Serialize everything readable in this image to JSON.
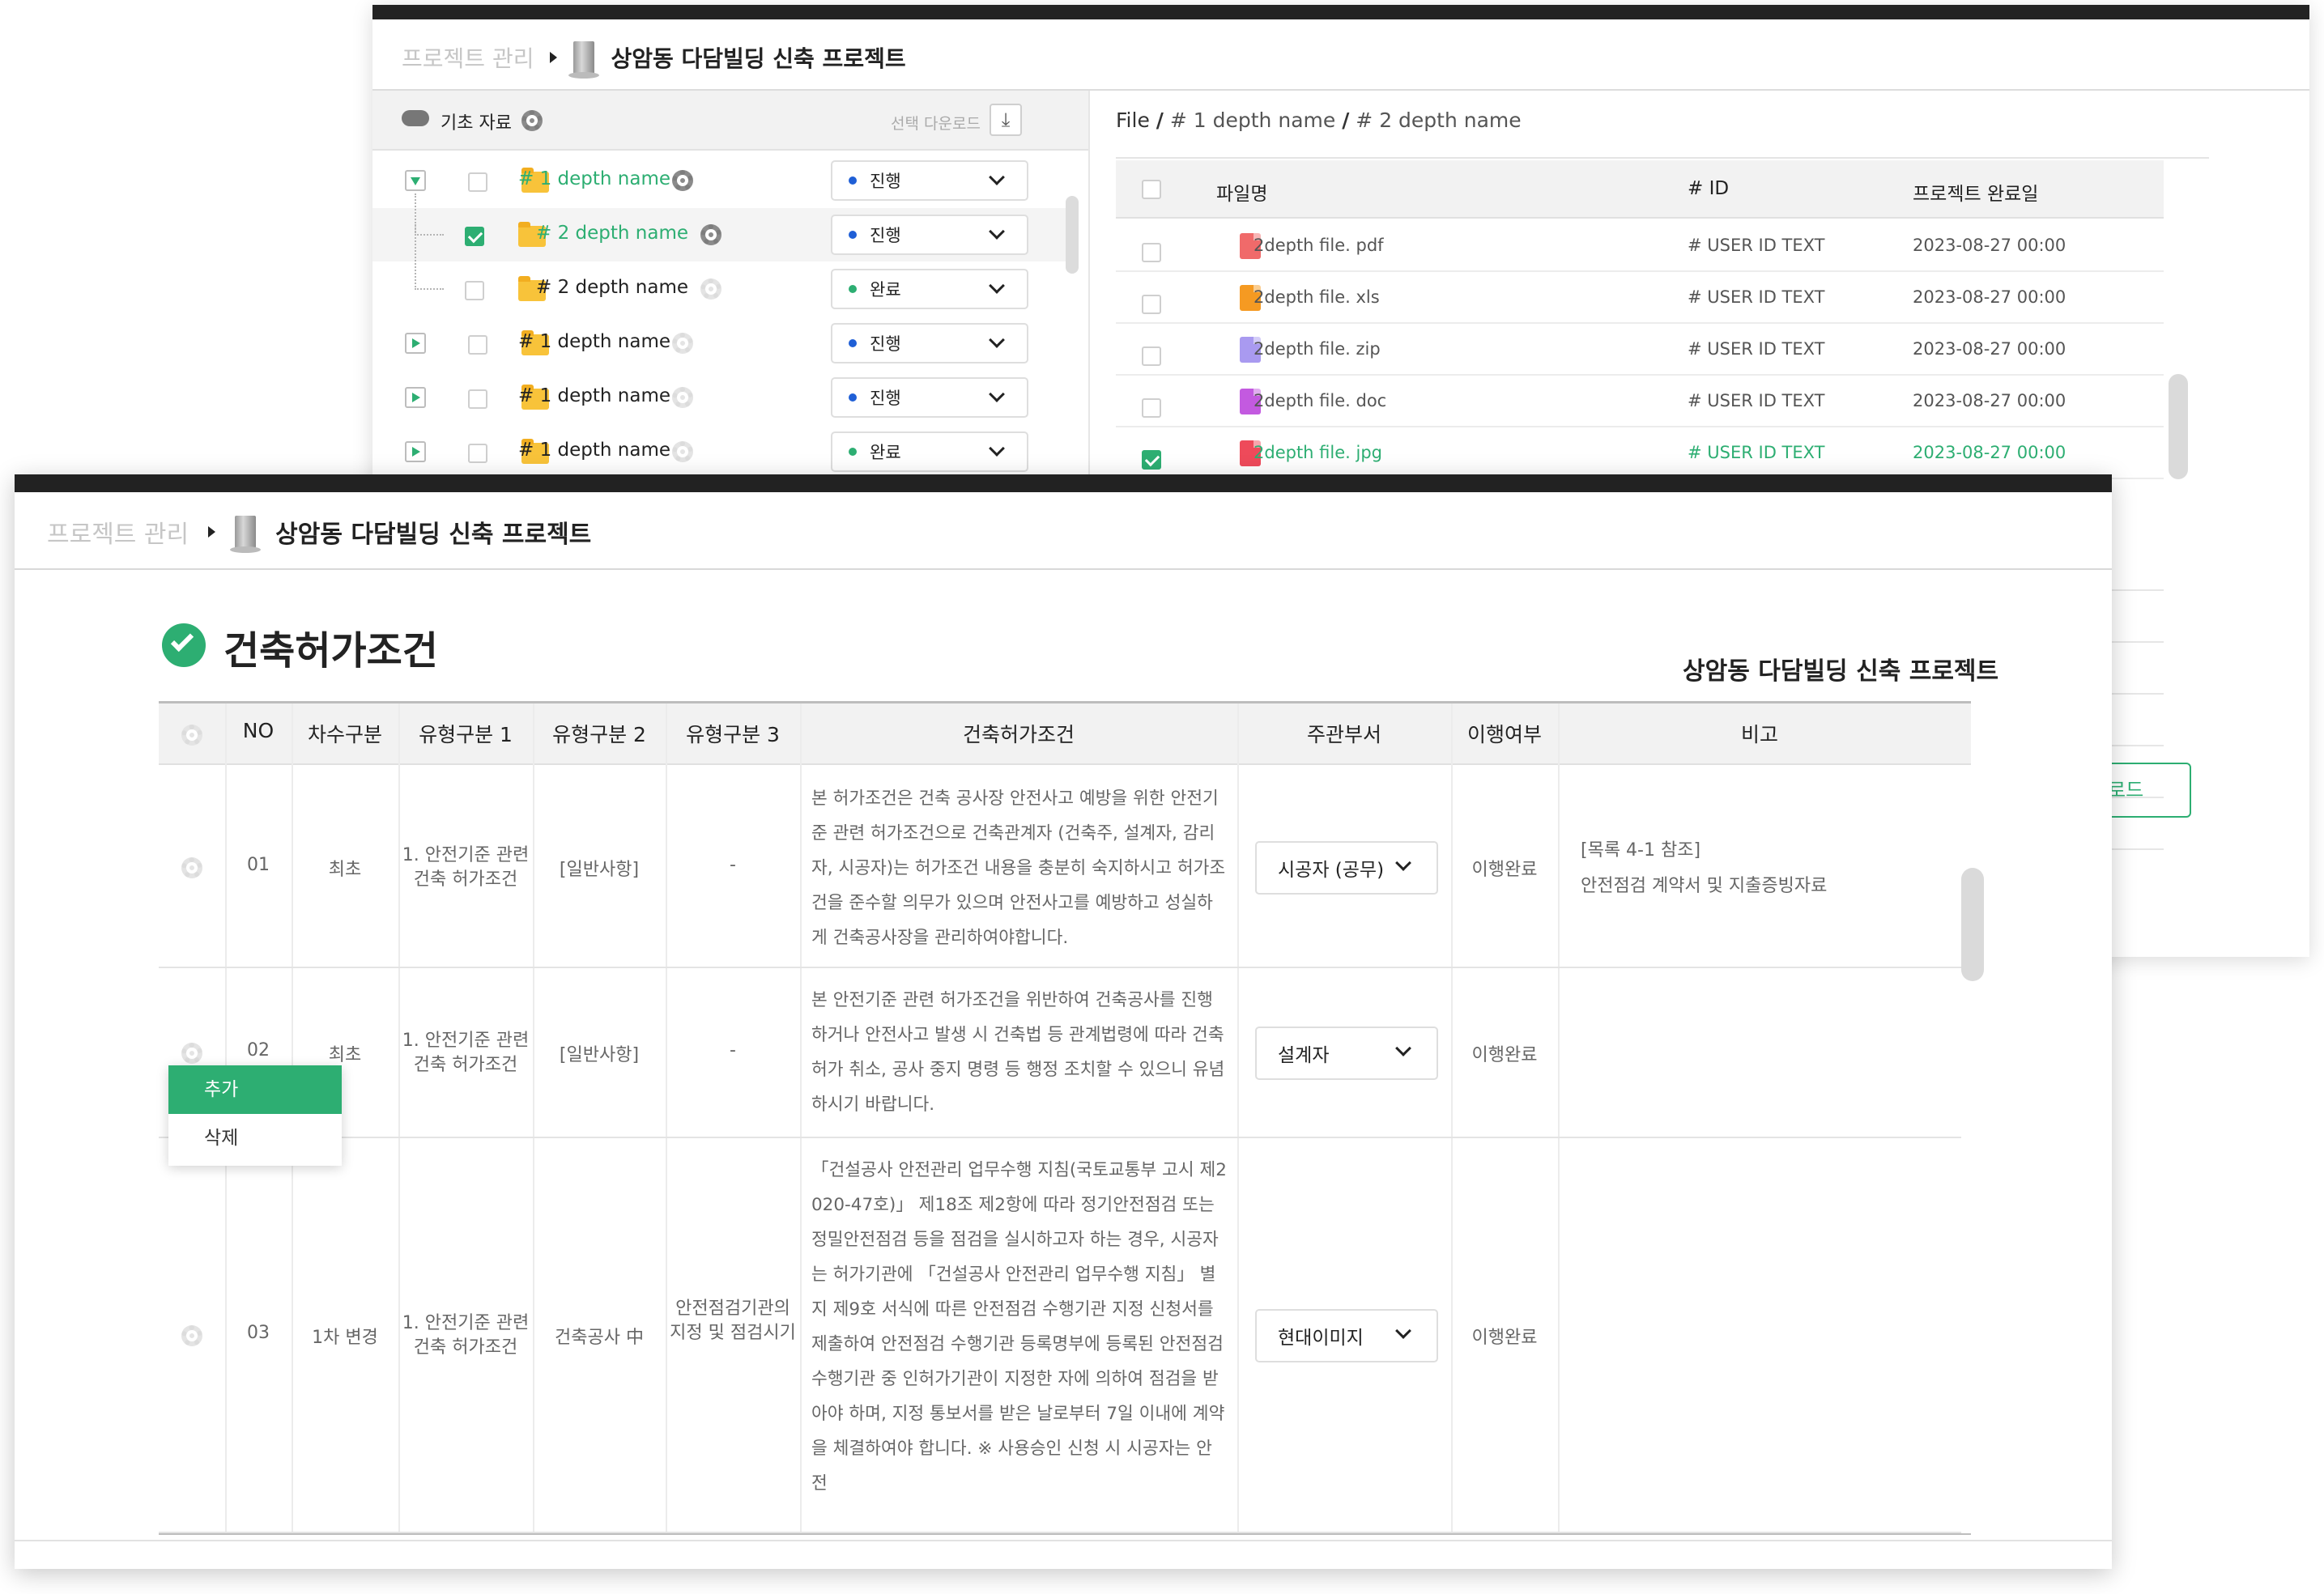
{
  "back_window": {
    "breadcrumb_root": "프로젝트 관리",
    "project_title": "상암동 다담빌딩 신축 프로젝트",
    "tree_header": {
      "label": "기초 자료",
      "download": "선택 다운로드"
    },
    "tree_items": [
      {
        "toggle": "open",
        "checked": false,
        "name": "# 1 depth name",
        "active": true,
        "status": "진행",
        "status_color": "#1f5fd6"
      },
      {
        "toggle": "none",
        "checked": true,
        "name": "# 2 depth name",
        "active": true,
        "status": "진행",
        "status_color": "#1f5fd6"
      },
      {
        "toggle": "none",
        "checked": false,
        "name": "# 2 depth name",
        "active": false,
        "status": "완료",
        "status_color": "#2dae72"
      },
      {
        "toggle": "closed",
        "checked": false,
        "name": "# 1 depth name",
        "active": false,
        "status": "진행",
        "status_color": "#1f5fd6"
      },
      {
        "toggle": "closed",
        "checked": false,
        "name": "# 1 depth name",
        "active": false,
        "status": "진행",
        "status_color": "#1f5fd6"
      },
      {
        "toggle": "closed",
        "checked": false,
        "name": "# 1 depth name",
        "active": false,
        "status": "완료",
        "status_color": "#2dae72"
      }
    ],
    "file_path": {
      "root": "File",
      "sep": "/",
      "d1": "# 1 depth name",
      "d2": "# 2 depth name"
    },
    "file_table": {
      "headers": [
        "파일명",
        "# ID",
        "프로젝트 완료일"
      ],
      "rows": [
        {
          "name": "2depth file. pdf",
          "type": "PDF",
          "color": "#f06a6a",
          "id": "# USER ID TEXT",
          "date": "2023-08-27 00:00",
          "checked": false
        },
        {
          "name": "2depth file. xls",
          "type": "XLS",
          "color": "#f59a22",
          "id": "# USER ID TEXT",
          "date": "2023-08-27 00:00",
          "checked": false
        },
        {
          "name": "2depth file. zip",
          "type": "ZIP",
          "color": "#a99af0",
          "id": "# USER ID TEXT",
          "date": "2023-08-27 00:00",
          "checked": false
        },
        {
          "name": "2depth file. doc",
          "type": "DOC",
          "color": "#c35ae0",
          "id": "# USER ID TEXT",
          "date": "2023-08-27 00:00",
          "checked": false
        },
        {
          "name": "2depth file. jpg",
          "type": "JPG",
          "color": "#ee4a5a",
          "id": "# USER ID TEXT",
          "date": "2023-08-27 00:00",
          "checked": true
        }
      ]
    },
    "download_button": "다운로드"
  },
  "front_window": {
    "breadcrumb_root": "프로젝트 관리",
    "project_title": "상암동 다담빌딩 신축 프로젝트",
    "page_title": "건축허가조건",
    "project_label": "상암동 다담빌딩 신축 프로젝트",
    "table": {
      "headers": [
        "NO",
        "차수구분",
        "유형구분 1",
        "유형구분 2",
        "유형구분 3",
        "건축허가조건",
        "주관부서",
        "이행여부",
        "비고"
      ],
      "rows": [
        {
          "no": "01",
          "degree": "최초",
          "type1": "1. 안전기준 관련 건축 허가조건",
          "type2": "[일반사항]",
          "type3": "-",
          "condition": "본 허가조건은 건축 공사장 안전사고 예방을 위한 안전기준 관련 허가조건으로 건축관계자 (건축주, 설계자, 감리자, 시공자)는 허가조건 내용을 충분히 숙지하시고 허가조건을 준수할 의무가 있으며 안전사고를 예방하고 성실하게 건축공사장을 관리하여야합니다.",
          "dept": "시공자 (공무)",
          "done": "이행완료",
          "note1": "[목록 4-1 참조]",
          "note2": "안전점검 계약서 및 지출증빙자료"
        },
        {
          "no": "02",
          "degree": "최초",
          "type1": "1. 안전기준 관련 건축 허가조건",
          "type2": "[일반사항]",
          "type3": "-",
          "condition": "본 안전기준 관련 허가조건을 위반하여 건축공사를 진행하거나 안전사고 발생 시 건축법 등 관계법령에 따라 건축허가 취소, 공사 중지 명령 등 행정 조치할 수 있으니 유념하시기 바랍니다.",
          "dept": "설계자",
          "done": "이행완료",
          "note1": "",
          "note2": ""
        },
        {
          "no": "03",
          "degree": "1차 변경",
          "type1": "1. 안전기준 관련 건축 허가조건",
          "type2": "건축공사 中",
          "type3": "안전점검기관의 지정 및 점검시기",
          "condition": "「건설공사 안전관리 업무수행 지침(국토교통부 고시 제2020-47호)」 제18조 제2항에 따라 정기안전점검 또는 정밀안전점검 등을 점검을 실시하고자 하는 경우, 시공자는 허가기관에 「건설공사 안전관리 업무수행 지침」 별지 제9호 서식에 따른 안전점검 수행기관 지정 신청서를 제출하여 안전점검 수행기관 등록명부에 등록된 안전점검 수행기관 중 인허가기관이 지정한 자에 의하여 점검을 받아야 하며, 지정 통보서를 받은 날로부터 7일 이내에 계약을 체결하여야 합니다. ※ 사용승인 신청 시 시공자는 안전",
          "dept": "현대이미지",
          "done": "이행완료",
          "note1": "",
          "note2": ""
        }
      ]
    },
    "context_menu": {
      "add": "추가",
      "delete": "삭제"
    }
  }
}
